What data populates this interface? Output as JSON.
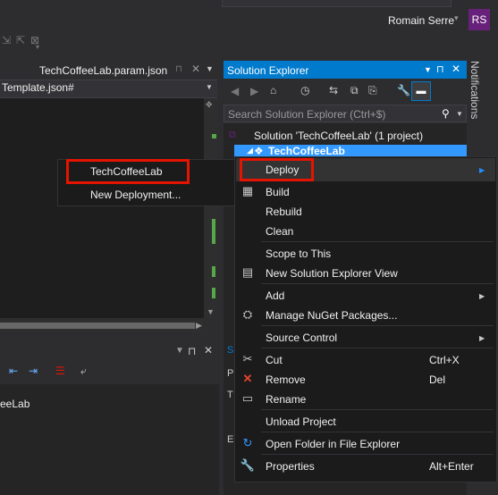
{
  "header": {
    "user_name": "Romain Serre",
    "avatar_initials": "RS",
    "user_caret": "▾"
  },
  "editor": {
    "tab_title": "TechCoffeeLab.param.json",
    "combo_text": "Template.json#"
  },
  "lower_panel": {
    "text": "eeLab"
  },
  "solution_explorer": {
    "title": "Solution Explorer",
    "search_placeholder": "Search Solution Explorer (Ctrl+$)",
    "solution_label": "Solution 'TechCoffeeLab' (1 project)",
    "project_label": "TechCoffeeLab"
  },
  "notifications_label": "Notifications",
  "deploy_submenu": {
    "items": [
      "TechCoffeeLab",
      "New Deployment..."
    ]
  },
  "context_menu": {
    "deploy": "Deploy",
    "build": "Build",
    "rebuild": "Rebuild",
    "clean": "Clean",
    "scope_to_this": "Scope to This",
    "new_se_view": "New Solution Explorer View",
    "add": "Add",
    "manage_nuget": "Manage NuGet Packages...",
    "source_control": "Source Control",
    "cut": "Cut",
    "cut_shortcut": "Ctrl+X",
    "remove": "Remove",
    "remove_shortcut": "Del",
    "rename": "Rename",
    "unload_project": "Unload Project",
    "open_folder": "Open Folder in File Explorer",
    "properties": "Properties",
    "properties_shortcut": "Alt+Enter"
  },
  "colors": {
    "accent": "#007acc",
    "selection": "#3399ff",
    "highlight_box": "#e51400",
    "avatar": "#68217a"
  }
}
